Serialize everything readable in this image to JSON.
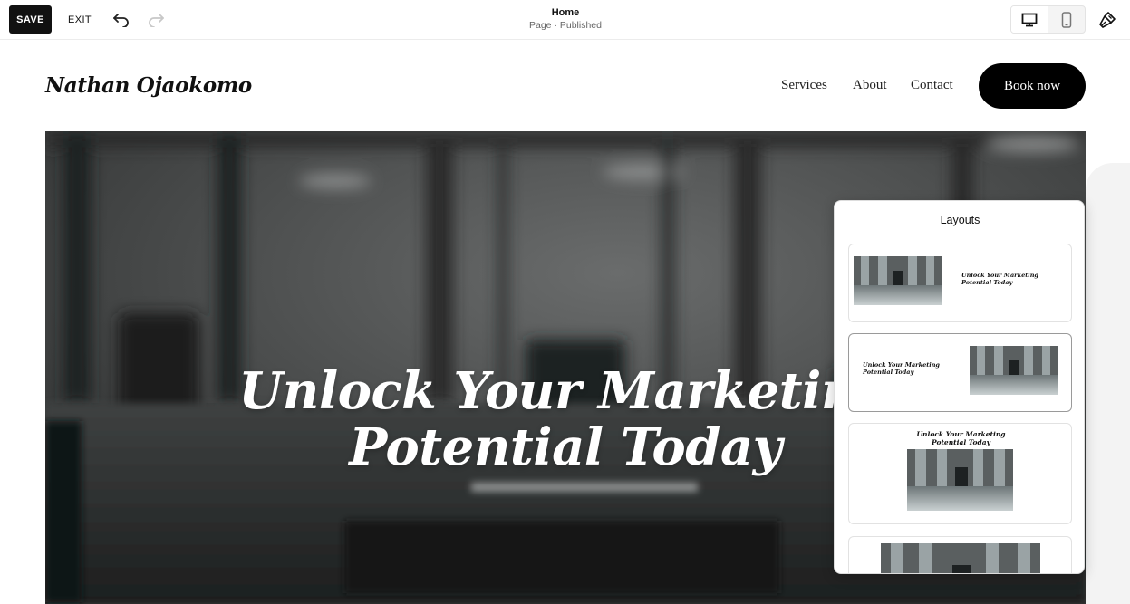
{
  "toolbar": {
    "save_label": "SAVE",
    "exit_label": "EXIT",
    "page_title": "Home",
    "page_status": "Page · Published"
  },
  "site": {
    "logo": "Nathan Ojaokomo",
    "nav": [
      "Services",
      "About",
      "Contact"
    ],
    "cta": "Book now"
  },
  "hero": {
    "heading_line1": "Unlock Your Marketing",
    "heading_line2": "Potential Today"
  },
  "layouts_panel": {
    "title": "Layouts",
    "cards": [
      {
        "text_line1": "Unlock Your Marketing",
        "text_line2": "Potential Today"
      },
      {
        "text_line1": "Unlock Your Marketing",
        "text_line2": "Potential Today"
      },
      {
        "text_line1": "Unlock Your Marketing",
        "text_line2": "Potential Today"
      },
      {
        "text_line1": "",
        "text_line2": ""
      }
    ]
  },
  "icons": {
    "undo": "undo-icon",
    "redo": "redo-icon",
    "desktop": "desktop-icon",
    "mobile": "mobile-icon",
    "style": "paintbrush-icon"
  },
  "colors": {
    "toolbar_button": "#111111",
    "cta_background": "#000000",
    "hero_overlay": "#4a4b4b"
  }
}
